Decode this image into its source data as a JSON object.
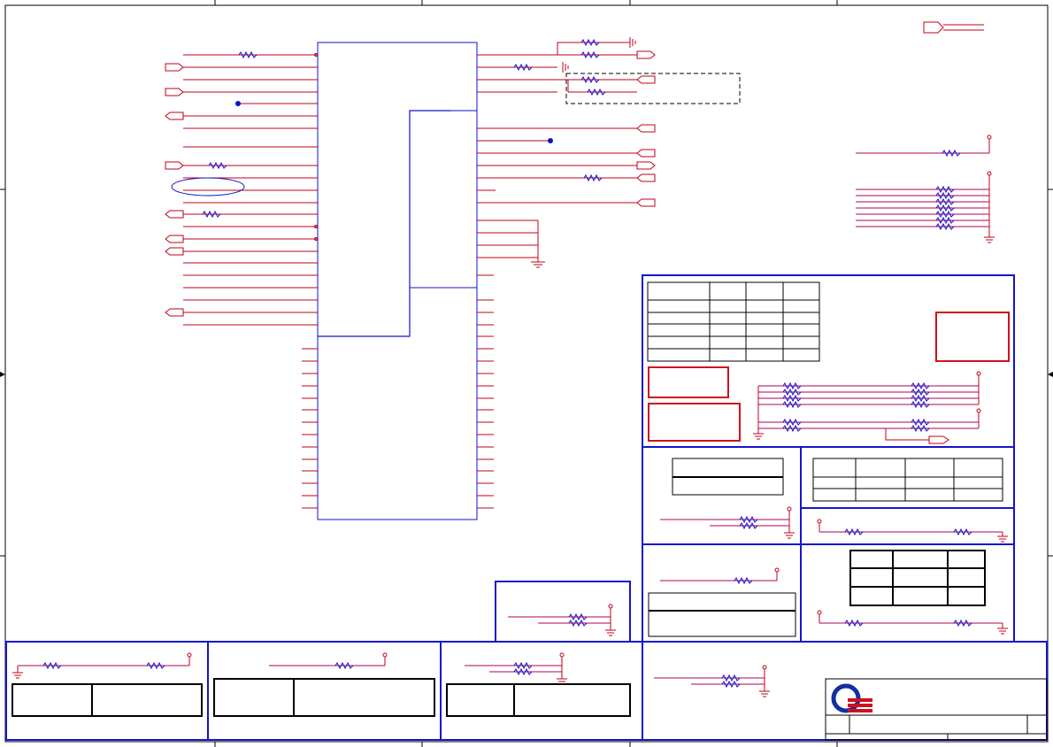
{
  "sheet": {
    "colors": {
      "wire": "#c00018",
      "bus": "#b0005a",
      "component": "#1010d0",
      "frame": "#1414cc",
      "border": "#000000",
      "logo_blue": "#1030a0",
      "logo_red": "#d01020"
    },
    "title_block": {
      "logo_icon": "company-logo-icon"
    }
  }
}
